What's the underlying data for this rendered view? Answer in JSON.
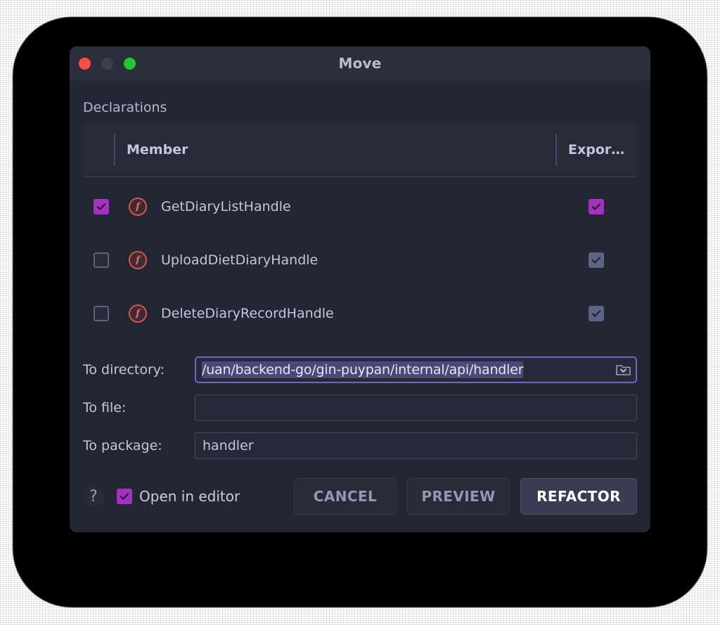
{
  "window": {
    "title": "Move",
    "traffic_lights": [
      "close-red",
      "minimize-inactive",
      "zoom-green"
    ]
  },
  "section": {
    "declarations_label": "Declarations"
  },
  "table": {
    "columns": [
      {
        "key": "member",
        "label": "Member"
      },
      {
        "key": "export",
        "label": "Expor…"
      }
    ],
    "rows": [
      {
        "selected": true,
        "icon": "function-icon",
        "icon_glyph": "f",
        "member": "GetDiaryListHandle",
        "export_checked": true,
        "export_enabled": true
      },
      {
        "selected": false,
        "icon": "function-icon",
        "icon_glyph": "f",
        "member": "UploadDietDiaryHandle",
        "export_checked": true,
        "export_enabled": false
      },
      {
        "selected": false,
        "icon": "function-icon",
        "icon_glyph": "f",
        "member": "DeleteDiaryRecordHandle",
        "export_checked": true,
        "export_enabled": false
      }
    ]
  },
  "form": {
    "to_directory": {
      "label": "To directory:",
      "value": "/uan/backend-go/gin-puypan/internal/api/handler",
      "placeholder": "",
      "selected": true,
      "browse_icon": "folder-dropdown-icon"
    },
    "to_file": {
      "label": "To file:",
      "value": "",
      "placeholder": ""
    },
    "to_package": {
      "label": "To package:",
      "value": "handler",
      "placeholder": ""
    }
  },
  "footer": {
    "help_icon": "question-mark-icon",
    "help_glyph": "?",
    "open_in_editor": {
      "label": "Open in editor",
      "checked": true
    },
    "buttons": [
      {
        "name": "cancel-button",
        "label": "CANCEL",
        "primary": false
      },
      {
        "name": "preview-button",
        "label": "PREVIEW",
        "primary": false
      },
      {
        "name": "refactor-button",
        "label": "REFACTOR",
        "primary": true
      }
    ]
  },
  "colors": {
    "dialog_bg": "#232633",
    "titlebar_bg": "#2b2e3b",
    "accent_purple": "#a62fc4",
    "focus_border": "#7a5fc4",
    "selection_bg": "#4d4878",
    "function_icon": "#d6564b",
    "text_primary": "#c3c7da",
    "primary_button_bg": "#383d54"
  }
}
